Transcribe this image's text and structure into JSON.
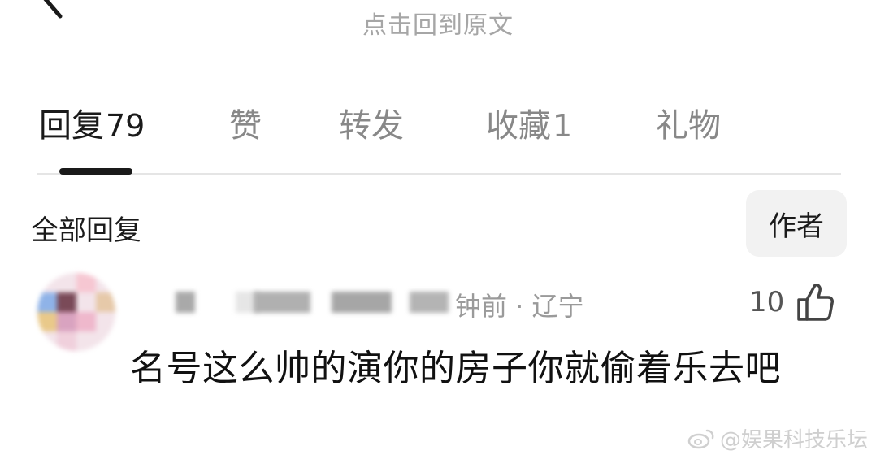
{
  "header": {
    "back_icon": "back-arrow-icon",
    "title": "点击回到原文"
  },
  "tabs": [
    {
      "label": "回复",
      "count": "79",
      "active": true
    },
    {
      "label": "赞",
      "count": "",
      "active": false
    },
    {
      "label": "转发",
      "count": "",
      "active": false
    },
    {
      "label": "收藏",
      "count": "1",
      "active": false
    },
    {
      "label": "礼物",
      "count": "",
      "active": false
    }
  ],
  "filters": {
    "section_title": "全部回复",
    "author_label": "作者"
  },
  "comment": {
    "username_redacted": true,
    "meta": "钟前 · 辽宁",
    "likes": "10",
    "like_icon": "thumbs-up-icon",
    "text": "名号这么帅的演你的房子你就偷着乐去吧"
  },
  "watermark": {
    "icon": "weibo-logo-icon",
    "text": "@娱果科技乐坛"
  }
}
